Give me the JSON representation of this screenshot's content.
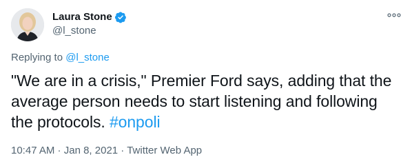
{
  "author": {
    "display_name": "Laura Stone",
    "handle": "@l_stone",
    "verified_icon": "verified-badge-icon"
  },
  "more_icon": "more-options-icon",
  "reply": {
    "prefix": "Replying to ",
    "handle": "@l_stone"
  },
  "tweet": {
    "text": "\"We are in a crisis,\" Premier Ford says, adding that the average person needs to start listening and following the protocols. ",
    "hashtag": "#onpoli"
  },
  "meta": {
    "time": "10:47 AM",
    "separator1": " · ",
    "date": "Jan 8, 2021",
    "separator2": " · ",
    "source": "Twitter Web App"
  },
  "colors": {
    "link": "#1d9bf0",
    "text": "#0f1419",
    "secondary": "#536471"
  }
}
